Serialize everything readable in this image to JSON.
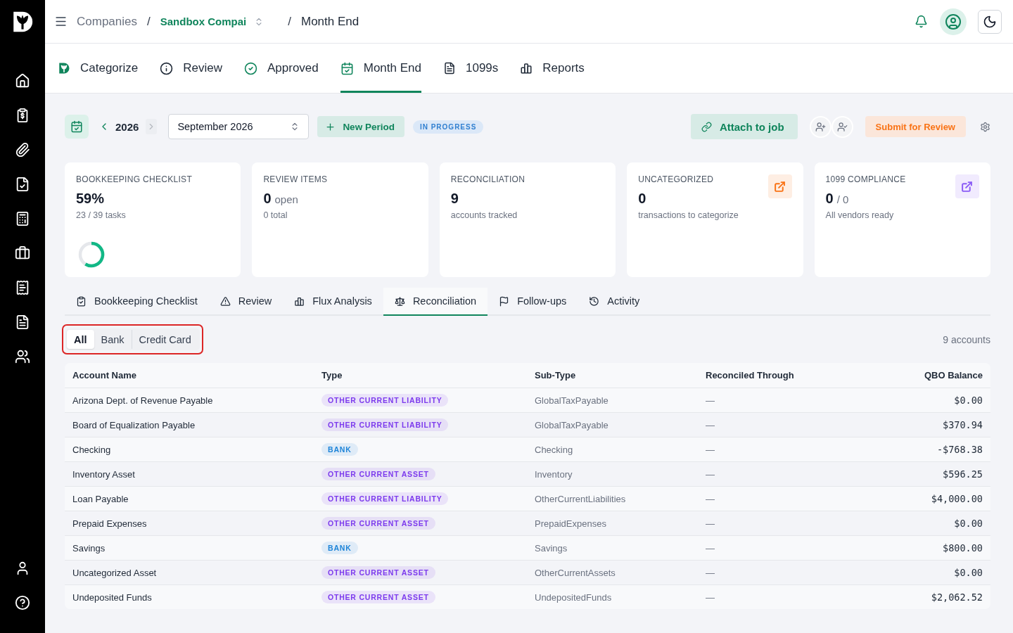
{
  "breadcrumb": [
    {
      "kind": "link",
      "label": "Companies"
    },
    {
      "kind": "separator",
      "label": "/"
    },
    {
      "kind": "picker",
      "label": "Sandbox Compai"
    },
    {
      "kind": "separator",
      "label": "/"
    },
    {
      "kind": "current",
      "label": "Month End"
    }
  ],
  "nav_tabs": [
    {
      "label": "Categorize",
      "selected": false
    },
    {
      "label": "Review",
      "selected": false
    },
    {
      "label": "Approved",
      "selected": false
    },
    {
      "label": "Month End",
      "selected": true
    },
    {
      "label": "1099s",
      "selected": false
    },
    {
      "label": "Reports",
      "selected": false
    }
  ],
  "period": {
    "previous_year": {
      "disabled": false
    },
    "year": "2026",
    "next_year": {
      "disabled": true
    },
    "month": "September 2026",
    "new_period": "New Period",
    "status": "IN PROGRESS"
  },
  "actions": {
    "attach": "Attach to job",
    "submit": "Submit for Review"
  },
  "cards": [
    {
      "kind": "progress",
      "label": "BOOKKEEPING CHECKLIST",
      "value": "59%",
      "sub": "23 / 39 tasks",
      "level": 0.59
    },
    {
      "kind": "plain",
      "label": "REVIEW ITEMS",
      "value": "0",
      "suffix": "open",
      "sub": "0 total"
    },
    {
      "kind": "plain",
      "label": "RECONCILIATION",
      "value": "9",
      "sub": "accounts tracked"
    },
    {
      "kind": "link",
      "label": "UNCATEGORIZED",
      "value": "0",
      "sub": "transactions to categorize",
      "color": "#f97316"
    },
    {
      "kind": "link",
      "label": "1099 COMPLIANCE",
      "value": "0",
      "suffix": "/ 0",
      "sub": "All vendors ready",
      "color": "#8b5cf6"
    }
  ],
  "section_tabs": [
    {
      "label": "Bookkeeping Checklist",
      "selected": false
    },
    {
      "label": "Review",
      "selected": false
    },
    {
      "label": "Flux Analysis",
      "selected": false
    },
    {
      "label": "Reconciliation",
      "selected": true
    },
    {
      "label": "Follow-ups",
      "selected": false
    },
    {
      "label": "Activity",
      "selected": false
    }
  ],
  "filter": {
    "highlighted": true,
    "options": [
      {
        "label": "All",
        "selected": true
      },
      {
        "label": "Bank",
        "selected": false
      },
      {
        "label": "Credit Card",
        "selected": false
      }
    ],
    "count": "9 accounts"
  },
  "table": {
    "columns": [
      "Account Name",
      "Type",
      "Sub-Type",
      "Reconciled Through",
      "QBO Balance"
    ],
    "rows": [
      {
        "account_name": "Arizona Dept. of Revenue Payable",
        "type": {
          "label": "OTHER CURRENT LIABILITY",
          "color": "#7c3aed"
        },
        "sub_type": "GlobalTaxPayable",
        "reconciled_through": "—",
        "qbo_balance": "$0.00"
      },
      {
        "account_name": "Board of Equalization Payable",
        "type": {
          "label": "OTHER CURRENT LIABILITY",
          "color": "#7c3aed"
        },
        "sub_type": "GlobalTaxPayable",
        "reconciled_through": "—",
        "qbo_balance": "$370.94"
      },
      {
        "account_name": "Checking",
        "type": {
          "label": "BANK",
          "color": "#1d84d8"
        },
        "sub_type": "Checking",
        "reconciled_through": "—",
        "qbo_balance": "-$768.38"
      },
      {
        "account_name": "Inventory Asset",
        "type": {
          "label": "OTHER CURRENT ASSET",
          "color": "#7c3aed"
        },
        "sub_type": "Inventory",
        "reconciled_through": "—",
        "qbo_balance": "$596.25"
      },
      {
        "account_name": "Loan Payable",
        "type": {
          "label": "OTHER CURRENT LIABILITY",
          "color": "#7c3aed"
        },
        "sub_type": "OtherCurrentLiabilities",
        "reconciled_through": "—",
        "qbo_balance": "$4,000.00"
      },
      {
        "account_name": "Prepaid Expenses",
        "type": {
          "label": "OTHER CURRENT ASSET",
          "color": "#7c3aed"
        },
        "sub_type": "PrepaidExpenses",
        "reconciled_through": "—",
        "qbo_balance": "$0.00"
      },
      {
        "account_name": "Savings",
        "type": {
          "label": "BANK",
          "color": "#1d84d8"
        },
        "sub_type": "Savings",
        "reconciled_through": "—",
        "qbo_balance": "$800.00"
      },
      {
        "account_name": "Uncategorized Asset",
        "type": {
          "label": "OTHER CURRENT ASSET",
          "color": "#7c3aed"
        },
        "sub_type": "OtherCurrentAssets",
        "reconciled_through": "—",
        "qbo_balance": "$0.00"
      },
      {
        "account_name": "Undeposited Funds",
        "type": {
          "label": "OTHER CURRENT ASSET",
          "color": "#7c3aed"
        },
        "sub_type": "UndepositedFunds",
        "reconciled_through": "—",
        "qbo_balance": "$2,062.52"
      }
    ]
  }
}
